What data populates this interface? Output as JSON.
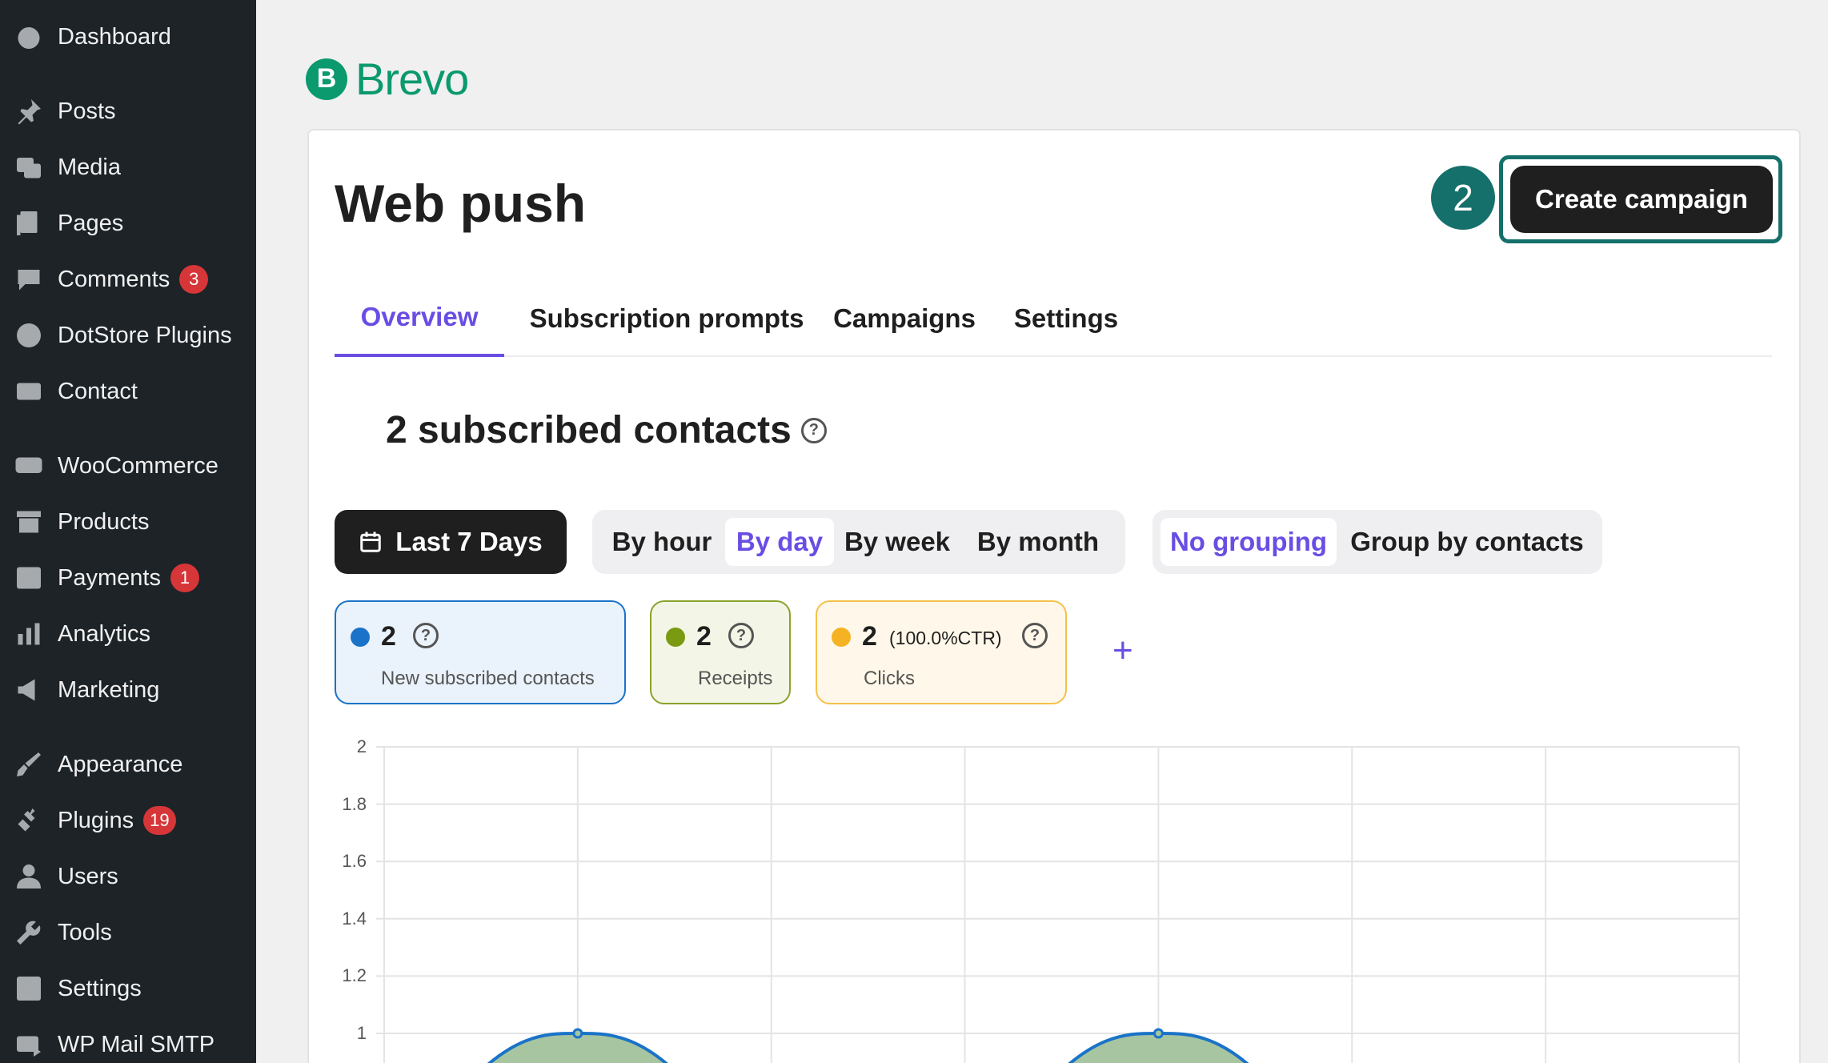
{
  "sidebar": {
    "items": [
      {
        "label": "Dashboard",
        "icon": "dashboard-icon"
      },
      {
        "label": "Posts",
        "icon": "pin-icon"
      },
      {
        "label": "Media",
        "icon": "media-icon"
      },
      {
        "label": "Pages",
        "icon": "pages-icon"
      },
      {
        "label": "Comments",
        "icon": "comment-icon",
        "badge": "3"
      },
      {
        "label": "DotStore Plugins",
        "icon": "circle-icon"
      },
      {
        "label": "Contact",
        "icon": "mail-icon"
      },
      {
        "label": "WooCommerce",
        "icon": "woo-icon"
      },
      {
        "label": "Products",
        "icon": "archive-icon"
      },
      {
        "label": "Payments",
        "icon": "dollar-icon",
        "badge": "1"
      },
      {
        "label": "Analytics",
        "icon": "bar-chart-icon"
      },
      {
        "label": "Marketing",
        "icon": "megaphone-icon"
      },
      {
        "label": "Appearance",
        "icon": "brush-icon"
      },
      {
        "label": "Plugins",
        "icon": "plug-icon",
        "badge": "19"
      },
      {
        "label": "Users",
        "icon": "user-icon"
      },
      {
        "label": "Tools",
        "icon": "wrench-icon"
      },
      {
        "label": "Settings",
        "icon": "settings-icon"
      },
      {
        "label": "WP Mail SMTP",
        "icon": "mail-arrow-icon"
      }
    ]
  },
  "brand": {
    "mark": "B",
    "name": "Brevo",
    "color": "#0b996e"
  },
  "page": {
    "title": "Web push",
    "step_number": "2",
    "create_label": "Create campaign"
  },
  "tabs": [
    {
      "label": "Overview",
      "active": true
    },
    {
      "label": "Subscription prompts",
      "active": false
    },
    {
      "label": "Campaigns",
      "active": false
    },
    {
      "label": "Settings",
      "active": false
    }
  ],
  "summary": {
    "text": "2 subscribed contacts",
    "help": "?"
  },
  "filters": {
    "date_range": "Last 7 Days",
    "granularity": [
      "By hour",
      "By day",
      "By week",
      "By month"
    ],
    "granularity_selected": "By day",
    "grouping": [
      "No grouping",
      "Group by contacts"
    ],
    "grouping_selected": "No grouping"
  },
  "metrics": [
    {
      "value": "2",
      "label": "New subscribed contacts",
      "color": "#1a73c8",
      "bg": "#eaf2fb",
      "border": "#1a73c8"
    },
    {
      "value": "2",
      "label": "Receipts",
      "color": "#7a9a12",
      "bg": "#f3f6e6",
      "border": "#8aa32a"
    },
    {
      "value": "2",
      "ctr": "(100.0%CTR)",
      "label": "Clicks",
      "color": "#f5b324",
      "bg": "#fff8ea",
      "border": "#f5c04a"
    }
  ],
  "add_metric": "+",
  "chart_data": {
    "type": "area",
    "y_ticks": [
      "2",
      "1.8",
      "1.6",
      "1.4",
      "1.2",
      "1"
    ],
    "ylim": [
      0,
      2
    ],
    "series": [
      {
        "values": [
          0,
          1,
          0,
          0,
          1,
          0,
          0,
          0
        ]
      }
    ],
    "colors": {
      "line": "#1a73c8",
      "fill": "#a6c5a0"
    },
    "grid": true
  }
}
